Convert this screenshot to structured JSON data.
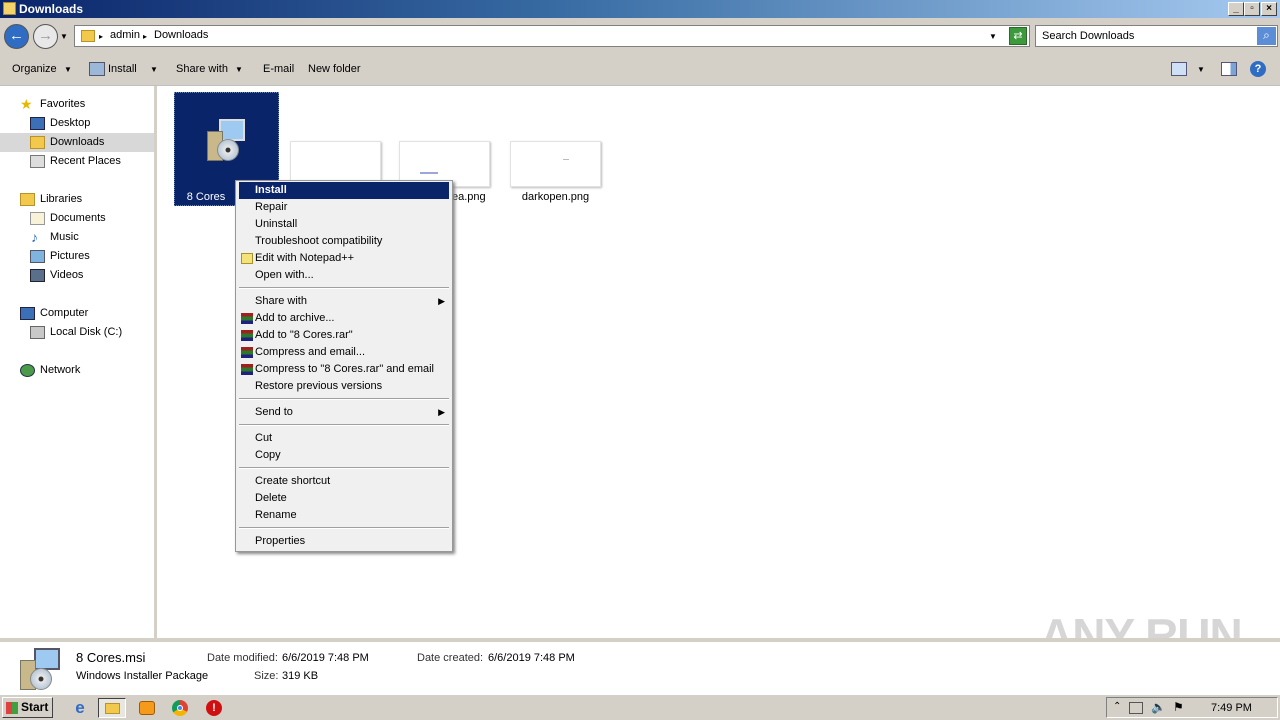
{
  "window": {
    "title": "Downloads"
  },
  "address": {
    "crumbs": [
      "admin",
      "Downloads"
    ],
    "search_placeholder": "Search Downloads"
  },
  "toolbar": {
    "organize": "Organize",
    "install": "Install",
    "share_with": "Share with",
    "email": "E-mail",
    "new_folder": "New folder"
  },
  "nav": {
    "favorites": "Favorites",
    "desktop": "Desktop",
    "downloads": "Downloads",
    "recent": "Recent Places",
    "libraries": "Libraries",
    "documents": "Documents",
    "music": "Music",
    "pictures": "Pictures",
    "videos": "Videos",
    "computer": "Computer",
    "local_disk": "Local Disk (C:)",
    "network": "Network"
  },
  "files": [
    {
      "name": "8 Cores"
    },
    {
      "name": "ea.png"
    },
    {
      "name": "darkopen.png"
    }
  ],
  "menu": {
    "install": "Install",
    "repair": "Repair",
    "uninstall": "Uninstall",
    "troubleshoot": "Troubleshoot compatibility",
    "notepad": "Edit with Notepad++",
    "open_with": "Open with...",
    "share_with": "Share with",
    "add_archive": "Add to archive...",
    "add_rar": "Add to \"8 Cores.rar\"",
    "compress_email": "Compress and email...",
    "compress_rar_email": "Compress to \"8 Cores.rar\" and email",
    "restore": "Restore previous versions",
    "send_to": "Send to",
    "cut": "Cut",
    "copy": "Copy",
    "create_shortcut": "Create shortcut",
    "delete": "Delete",
    "rename": "Rename",
    "properties": "Properties"
  },
  "details": {
    "filename": "8 Cores.msi",
    "type": "Windows Installer Package",
    "modified_label": "Date modified:",
    "modified": "6/6/2019 7:48 PM",
    "size_label": "Size:",
    "size": "319 KB",
    "created_label": "Date created:",
    "created": "6/6/2019 7:48 PM"
  },
  "taskbar": {
    "start": "Start",
    "clock": "7:49 PM"
  },
  "watermark": "ANY RUN"
}
